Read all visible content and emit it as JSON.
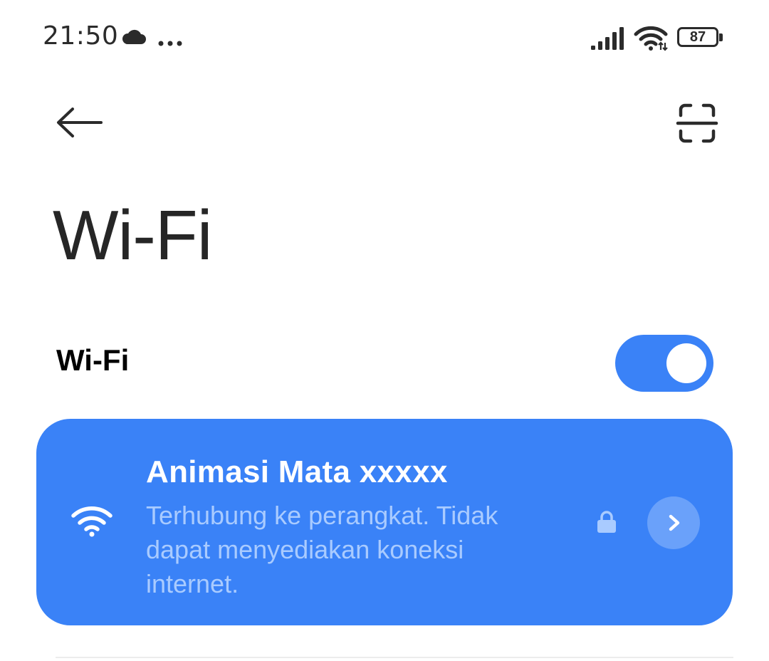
{
  "status_bar": {
    "time": "21:50",
    "battery_level": "87",
    "icons": [
      "cloud-icon",
      "more-dots-icon",
      "signal-icon",
      "wifi-icon",
      "battery-icon"
    ]
  },
  "toolbar": {
    "back_icon": "arrow-left-icon",
    "scan_icon": "scan-qr-icon"
  },
  "page": {
    "title": "Wi-Fi"
  },
  "wifi_toggle": {
    "label": "Wi-Fi",
    "enabled": true
  },
  "connected_network": {
    "name": "Animasi Mata xxxxx",
    "status": "Terhubung ke perangkat. Tidak dapat menyediakan koneksi internet.",
    "secured": true,
    "icons": [
      "wifi-icon",
      "lock-icon",
      "chevron-right-icon"
    ]
  },
  "colors": {
    "accent": "#3a82f7",
    "card_status_text": "#a9cbff",
    "detail_button": "#6aa1fa"
  }
}
